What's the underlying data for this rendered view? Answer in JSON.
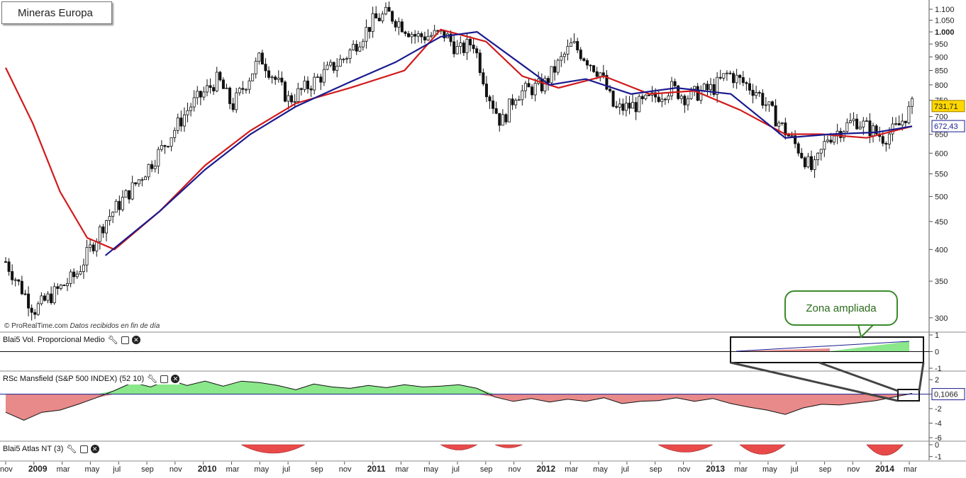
{
  "chart_data": [
    {
      "type": "candlestick",
      "title": "Mineras Europa",
      "credit": "© ProRealTime.com",
      "credit_note": "Datos recibidos en fin de día",
      "y_ticks": [
        "1.100",
        "1.050",
        "1.000",
        "950",
        "900",
        "850",
        "800",
        "750",
        "700",
        "650",
        "600",
        "550",
        "500",
        "450",
        "400",
        "350",
        "300"
      ],
      "y_tick_values": [
        1100,
        1050,
        1000,
        950,
        900,
        850,
        800,
        750,
        700,
        650,
        600,
        550,
        500,
        450,
        400,
        350,
        300
      ],
      "ylim": [
        285,
        1130
      ],
      "log_scale": true,
      "x_labels": [
        "nov",
        "2009",
        "mar",
        "may",
        "jul",
        "sep",
        "nov",
        "2010",
        "mar",
        "may",
        "jul",
        "sep",
        "nov",
        "2011",
        "mar",
        "may",
        "jul",
        "sep",
        "nov",
        "2012",
        "mar",
        "may",
        "jul",
        "sep",
        "nov",
        "2013",
        "mar",
        "may",
        "jul",
        "sep",
        "nov",
        "2014",
        "mar"
      ],
      "x_label_bold": [
        "2009",
        "2010",
        "2011",
        "2012",
        "2013",
        "2014"
      ],
      "price_key_points": [
        {
          "x": "2008-10",
          "close": 380
        },
        {
          "x": "2008-12",
          "close": 310
        },
        {
          "x": "2009-03",
          "close": 360
        },
        {
          "x": "2009-05",
          "close": 450
        },
        {
          "x": "2009-07",
          "close": 520
        },
        {
          "x": "2009-09",
          "close": 610
        },
        {
          "x": "2009-11",
          "close": 730
        },
        {
          "x": "2010-01",
          "close": 820
        },
        {
          "x": "2010-02",
          "close": 730
        },
        {
          "x": "2010-04",
          "close": 900
        },
        {
          "x": "2010-06",
          "close": 750
        },
        {
          "x": "2010-08",
          "close": 820
        },
        {
          "x": "2010-10",
          "close": 900
        },
        {
          "x": "2010-12",
          "close": 1050
        },
        {
          "x": "2011-01",
          "close": 1080
        },
        {
          "x": "2011-03",
          "close": 980
        },
        {
          "x": "2011-05",
          "close": 990
        },
        {
          "x": "2011-06",
          "close": 920
        },
        {
          "x": "2011-07",
          "close": 960
        },
        {
          "x": "2011-08",
          "close": 780
        },
        {
          "x": "2011-09",
          "close": 680
        },
        {
          "x": "2011-10",
          "close": 770
        },
        {
          "x": "2011-12",
          "close": 800
        },
        {
          "x": "2012-02",
          "close": 950
        },
        {
          "x": "2012-04",
          "close": 840
        },
        {
          "x": "2012-05",
          "close": 720
        },
        {
          "x": "2012-07",
          "close": 740
        },
        {
          "x": "2012-09",
          "close": 790
        },
        {
          "x": "2012-10",
          "close": 760
        },
        {
          "x": "2012-12",
          "close": 790
        },
        {
          "x": "2013-01",
          "close": 840
        },
        {
          "x": "2013-03",
          "close": 780
        },
        {
          "x": "2013-05",
          "close": 660
        },
        {
          "x": "2013-06",
          "close": 610
        },
        {
          "x": "2013-07",
          "close": 555
        },
        {
          "x": "2013-08",
          "close": 640
        },
        {
          "x": "2013-10",
          "close": 690
        },
        {
          "x": "2013-12",
          "close": 640
        },
        {
          "x": "2014-01",
          "close": 670
        },
        {
          "x": "2014-02",
          "close": 731.71
        }
      ],
      "series": [
        {
          "name": "",
          "color": "#d11a1a",
          "points": [
            [
              0,
              860
            ],
            [
              0.03,
              680
            ],
            [
              0.06,
              510
            ],
            [
              0.09,
              420
            ],
            [
              0.12,
              400
            ],
            [
              0.17,
              470
            ],
            [
              0.22,
              570
            ],
            [
              0.27,
              660
            ],
            [
              0.32,
              740
            ],
            [
              0.38,
              790
            ],
            [
              0.44,
              850
            ],
            [
              0.48,
              1010
            ],
            [
              0.53,
              960
            ],
            [
              0.57,
              830
            ],
            [
              0.61,
              790
            ],
            [
              0.66,
              830
            ],
            [
              0.71,
              770
            ],
            [
              0.76,
              780
            ],
            [
              0.81,
              720
            ],
            [
              0.86,
              650
            ],
            [
              0.9,
              650
            ],
            [
              0.95,
              640
            ],
            [
              1,
              672
            ]
          ]
        },
        {
          "name": "",
          "color": "#1a1a8f",
          "points": [
            [
              0.11,
              390
            ],
            [
              0.17,
              470
            ],
            [
              0.22,
              560
            ],
            [
              0.27,
              650
            ],
            [
              0.32,
              730
            ],
            [
              0.38,
              810
            ],
            [
              0.43,
              880
            ],
            [
              0.48,
              980
            ],
            [
              0.52,
              1000
            ],
            [
              0.57,
              870
            ],
            [
              0.6,
              800
            ],
            [
              0.64,
              820
            ],
            [
              0.69,
              770
            ],
            [
              0.74,
              790
            ],
            [
              0.8,
              770
            ],
            [
              0.86,
              640
            ],
            [
              0.91,
              650
            ],
            [
              0.96,
              655
            ],
            [
              1,
              672
            ]
          ]
        }
      ],
      "last_price": "731,71",
      "ma_value": "672,43"
    },
    {
      "type": "area",
      "title": "Blai5 Vol. Proporcional Medio",
      "y_ticks": [
        "1",
        "0",
        "-1"
      ],
      "ylim": [
        -1,
        1
      ],
      "baseline": 0
    },
    {
      "type": "area",
      "title": "RSc Mansfield (S&P 500 INDEX) (52 10)",
      "y_ticks": [
        "2",
        "0",
        "-2",
        "-4",
        "-6"
      ],
      "ylim": [
        -6,
        2.5
      ],
      "baseline": 0,
      "positive_color": "#8ae88a",
      "negative_color": "#e88a8a",
      "last_value": "0,1066"
    },
    {
      "type": "area",
      "title": "Blai5 Atlas NT (3)",
      "y_ticks": [
        "0",
        "-1"
      ],
      "ylim": [
        -1.2,
        0
      ],
      "color": "#e84a4a"
    }
  ],
  "annotation": "Zona ampliada",
  "colors": {
    "ma_red": "#d11a1a",
    "ma_blue": "#1a1a8f",
    "last_price_bg": "#ffd700",
    "callout_green": "#3a8a2a",
    "rsc_positive": "#8ae88a",
    "rsc_negative": "#e88a8a"
  }
}
